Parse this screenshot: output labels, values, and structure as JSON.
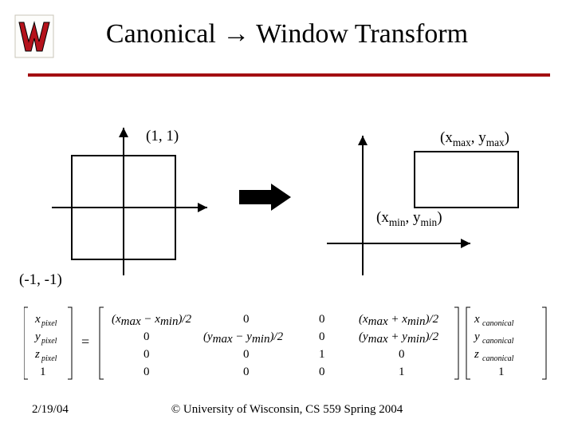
{
  "title": "Canonical → Window Transform",
  "labels": {
    "top_left_corner": "(1, 1)",
    "bottom_left_corner": "(-1, -1)",
    "right_top": "(x",
    "right_top_sub1": "max",
    "right_top_mid": ", y",
    "right_top_sub2": "max",
    "right_top_end": ")",
    "right_bot": "(x",
    "right_bot_sub1": "min",
    "right_bot_mid": ", y",
    "right_bot_sub2": "min",
    "right_bot_end": ")"
  },
  "matrix": {
    "out_vec": [
      "x",
      "pixel",
      "y",
      "pixel",
      "z",
      "pixel",
      "1"
    ],
    "row1": {
      "a": "(x",
      "a_sub": "max",
      "b": " − x",
      "b_sub": "min",
      "c": ")/2",
      "d": "0",
      "e": "0",
      "f": "(x",
      "f_sub": "max",
      "g": " + x",
      "g_sub": "min",
      "h": ")/2"
    },
    "row2": {
      "a": "0",
      "b": "(y",
      "b_sub": "max",
      "c": " − y",
      "c_sub": "min",
      "d": ")/2",
      "e": "0",
      "f": "(y",
      "f_sub": "max",
      "g": " + y",
      "g_sub": "min",
      "h": ")/2"
    },
    "row3": [
      "0",
      "0",
      "1",
      "0"
    ],
    "row4": [
      "0",
      "0",
      "0",
      "1"
    ],
    "in_vec": [
      "x",
      "canonical",
      "y",
      "canonical",
      "z",
      "canonical",
      "1"
    ]
  },
  "footer": {
    "date": "2/19/04",
    "copyright": "© University of Wisconsin, CS 559 Spring 2004"
  }
}
